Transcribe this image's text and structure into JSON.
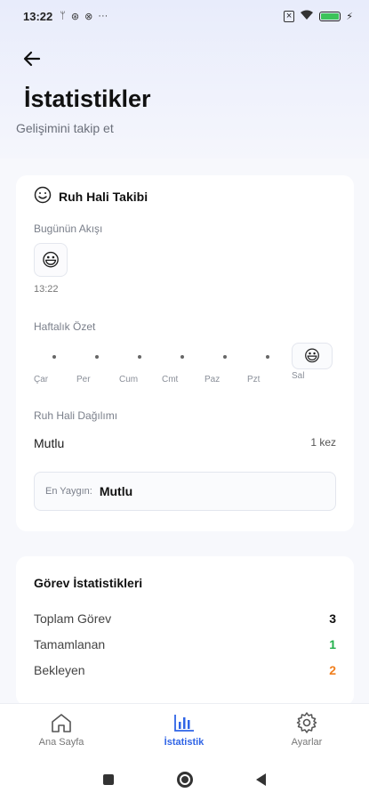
{
  "status": {
    "time": "13:22",
    "icons": [
      "usb-icon",
      "location-icon",
      "vpn-icon",
      "more-dots-icon"
    ],
    "right_icons": [
      "sim-off-icon",
      "wifi-icon",
      "battery-icon",
      "charging-icon"
    ]
  },
  "header": {
    "back_icon": "arrow-left-icon",
    "title": "İstatistikler",
    "subtitle": "Gelişimini takip et"
  },
  "mood_card": {
    "icon": "smiley-icon",
    "title": "Ruh Hali Takibi",
    "today_flow_label": "Bugünün Akışı",
    "today_entry": {
      "emoji": "😃",
      "time": "13:22"
    },
    "weekly_label": "Haftalık Özet",
    "week": [
      {
        "label": "Çar",
        "emoji": ""
      },
      {
        "label": "Per",
        "emoji": ""
      },
      {
        "label": "Cum",
        "emoji": ""
      },
      {
        "label": "Cmt",
        "emoji": ""
      },
      {
        "label": "Paz",
        "emoji": ""
      },
      {
        "label": "Pzt",
        "emoji": ""
      },
      {
        "label": "Sal",
        "emoji": "😃"
      }
    ],
    "distribution_label": "Ruh Hali Dağılımı",
    "distribution": [
      {
        "name": "Mutlu",
        "count": "1 kez"
      }
    ],
    "most_common_label": "En Yaygın:",
    "most_common_value": "Mutlu"
  },
  "task_card": {
    "title": "Görev İstatistikleri",
    "rows": [
      {
        "label": "Toplam Görev",
        "value": "3",
        "color": "#111111"
      },
      {
        "label": "Tamamlanan",
        "value": "1",
        "color": "#22b04b"
      },
      {
        "label": "Bekleyen",
        "value": "2",
        "color": "#f07f1e"
      }
    ]
  },
  "nav": {
    "items": [
      {
        "label": "Ana Sayfa",
        "icon": "home-icon",
        "active": false
      },
      {
        "label": "İstatistik",
        "icon": "bar-chart-icon",
        "active": true
      },
      {
        "label": "Ayarlar",
        "icon": "gear-icon",
        "active": false
      }
    ]
  },
  "colors": {
    "accent": "#2f64e6",
    "battery": "#3cc35a"
  }
}
